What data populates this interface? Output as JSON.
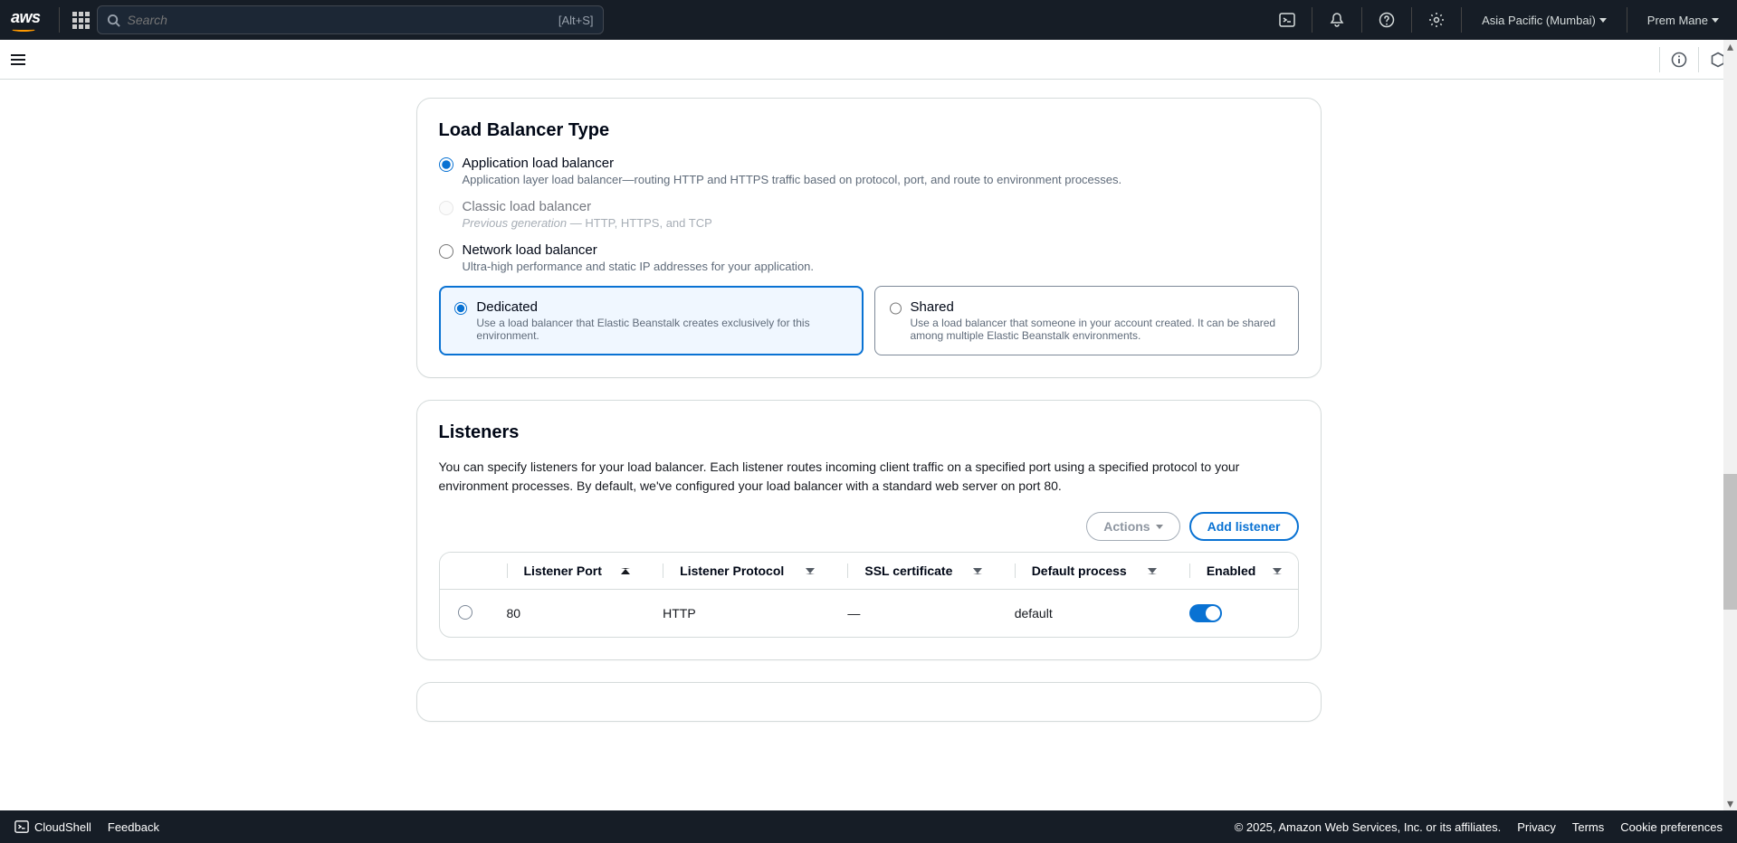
{
  "header": {
    "search_placeholder": "Search",
    "search_hint": "[Alt+S]",
    "region": "Asia Pacific (Mumbai)",
    "user": "Prem Mane"
  },
  "lb_type": {
    "title": "Load Balancer Type",
    "options": {
      "app": {
        "label": "Application load balancer",
        "desc": "Application layer load balancer—routing HTTP and HTTPS traffic based on protocol, port, and route to environment processes."
      },
      "classic": {
        "label": "Classic load balancer",
        "desc_prefix": "Previous generation",
        "desc_suffix": " — HTTP, HTTPS, and TCP"
      },
      "network": {
        "label": "Network load balancer",
        "desc": "Ultra-high performance and static IP addresses for your application."
      }
    },
    "mode": {
      "dedicated": {
        "label": "Dedicated",
        "desc": "Use a load balancer that Elastic Beanstalk creates exclusively for this environment."
      },
      "shared": {
        "label": "Shared",
        "desc": "Use a load balancer that someone in your account created. It can be shared among multiple Elastic Beanstalk environments."
      }
    }
  },
  "listeners": {
    "title": "Listeners",
    "desc": "You can specify listeners for your load balancer. Each listener routes incoming client traffic on a specified port using a specified protocol to your environment processes. By default, we've configured your load balancer with a standard web server on port 80.",
    "actions_label": "Actions",
    "add_label": "Add listener",
    "columns": {
      "port": "Listener Port",
      "protocol": "Listener Protocol",
      "ssl": "SSL certificate",
      "default_process": "Default process",
      "enabled": "Enabled"
    },
    "rows": [
      {
        "port": "80",
        "protocol": "HTTP",
        "ssl": "—",
        "default_process": "default",
        "enabled": true
      }
    ]
  },
  "footer": {
    "cloudshell": "CloudShell",
    "feedback": "Feedback",
    "copyright": "© 2025, Amazon Web Services, Inc. or its affiliates.",
    "privacy": "Privacy",
    "terms": "Terms",
    "cookies": "Cookie preferences"
  }
}
